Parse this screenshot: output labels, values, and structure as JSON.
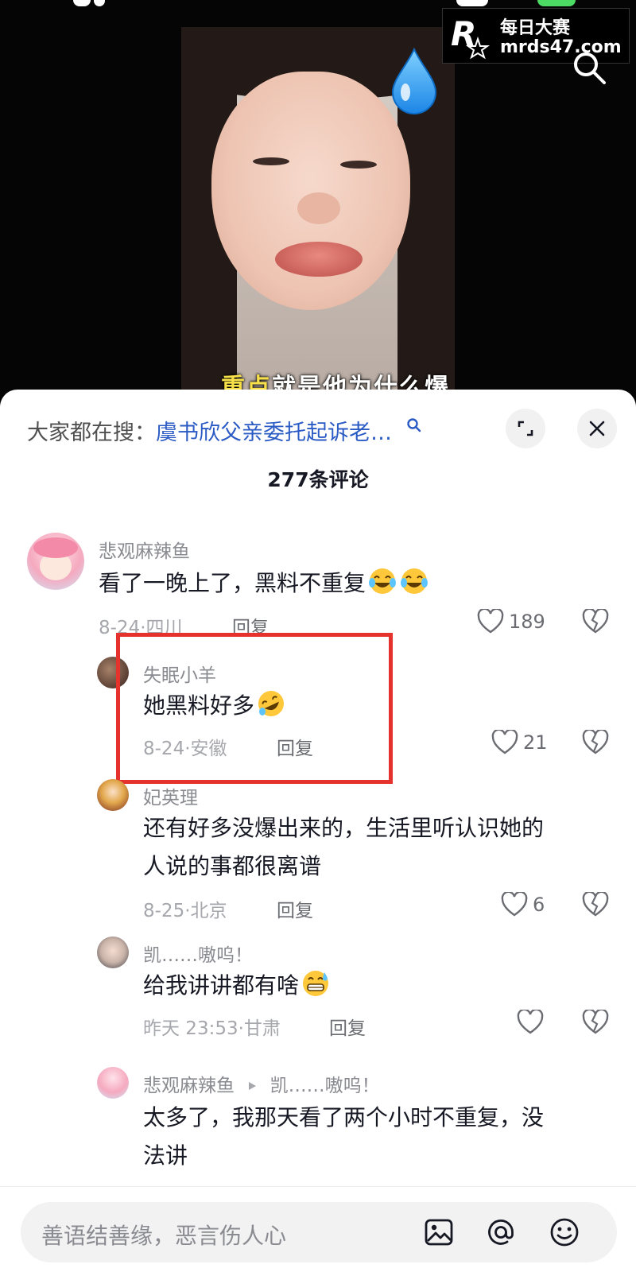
{
  "watermark": {
    "title": "每日大赛",
    "url": "mrds47.com"
  },
  "video": {
    "subtitle_highlight": "重点",
    "subtitle_rest": "就是他为什么爆"
  },
  "sheet": {
    "search_prefix": "大家都在搜：",
    "search_query": "虞书欣父亲委托起诉老…",
    "comment_count": "277条评论"
  },
  "comments": [
    {
      "user": "悲观麻辣鱼",
      "text": "看了一晚上了，黑料不重复",
      "emoji": [
        "laugh-cry-emoji",
        "laugh-cry-emoji"
      ],
      "date": "8-24",
      "location": "四川",
      "reply": "回复",
      "likes": "189"
    },
    {
      "user": "失眠小羊",
      "text": "她黑料好多",
      "emoji": [
        "rofl-emoji"
      ],
      "date": "8-24",
      "location": "安徽",
      "reply": "回复",
      "likes": "21"
    },
    {
      "user": "妃英理",
      "text_line1": "还有好多没爆出来的，生活里听认识她的",
      "text_line2": "人说的事都很离谱",
      "date": "8-25",
      "location": "北京",
      "reply": "回复",
      "likes": "6"
    },
    {
      "user": "凯……嗷呜！",
      "text": "给我讲讲都有啥",
      "emoji": [
        "grin-sweat-emoji"
      ],
      "date": "昨天 23:53",
      "location": "甘肃",
      "reply": "回复",
      "likes": ""
    },
    {
      "user": "悲观麻辣鱼",
      "reply_to": "凯……嗷呜！",
      "text_line1": "太多了，我那天看了两个小时不重复，没",
      "text_line2": "法讲"
    }
  ],
  "meta_separator": "·",
  "input": {
    "placeholder": "善语结善缘，恶言伤人心"
  },
  "colors": {
    "highlight_box": "#e5322d",
    "search_link": "#2a5ac4",
    "subtitle_highlight": "#f7e04a"
  }
}
